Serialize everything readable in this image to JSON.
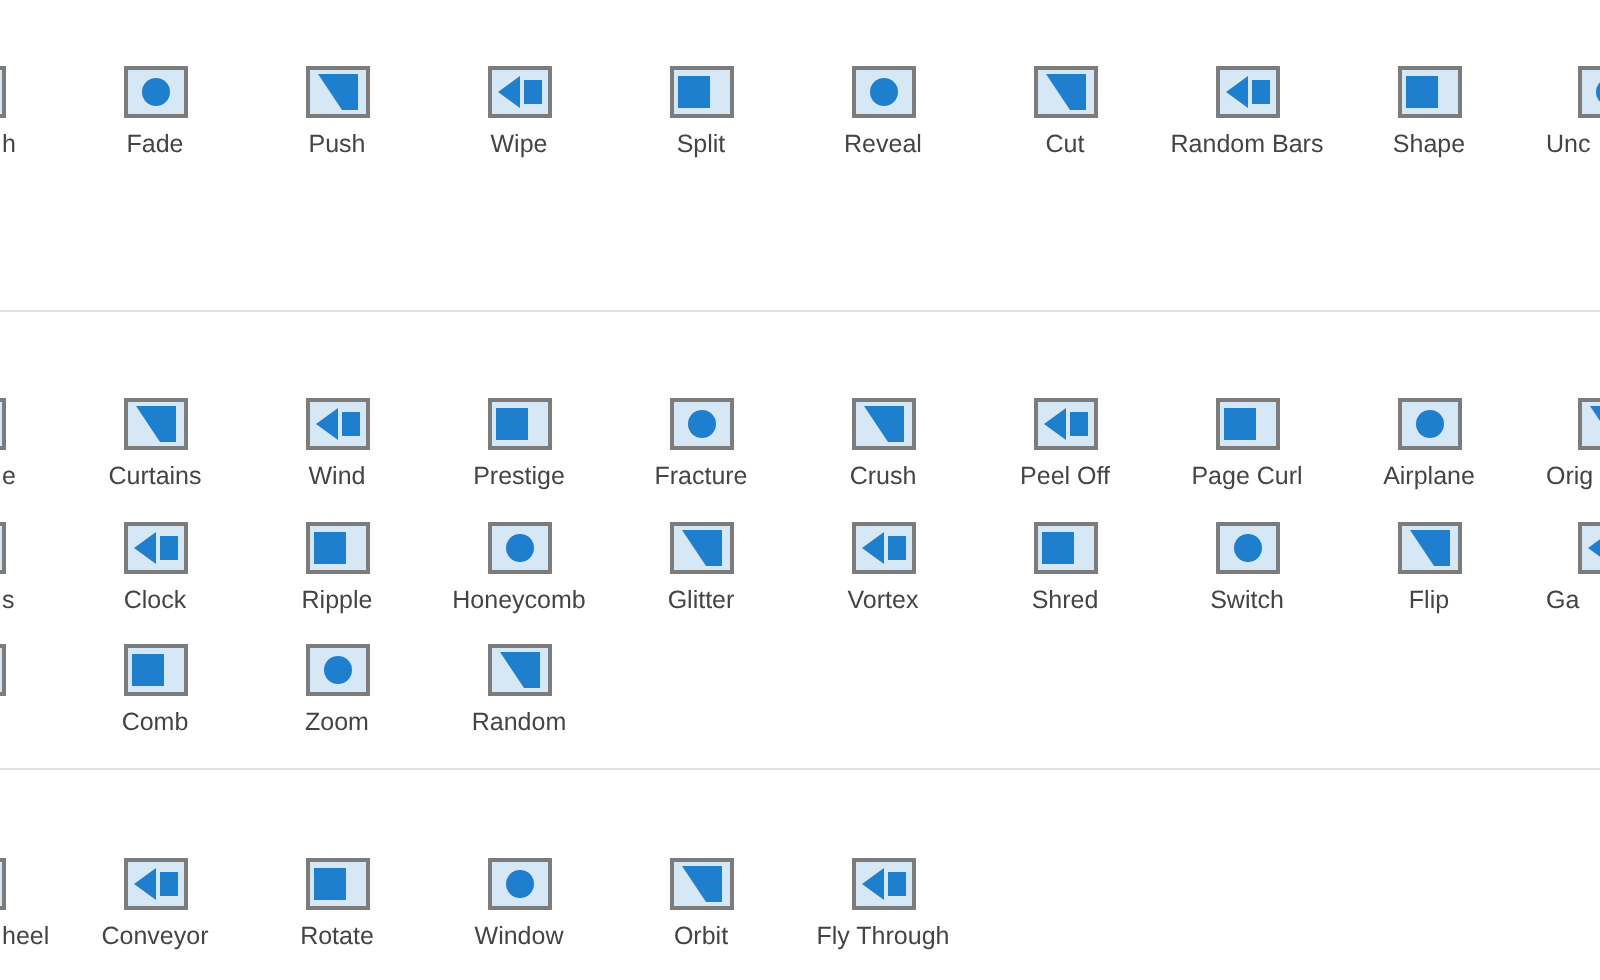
{
  "sections": [
    {
      "rows": [
        [
          {
            "label": "h"
          },
          {
            "label": "Fade"
          },
          {
            "label": "Push"
          },
          {
            "label": "Wipe"
          },
          {
            "label": "Split"
          },
          {
            "label": "Reveal"
          },
          {
            "label": "Cut"
          },
          {
            "label": "Random Bars"
          },
          {
            "label": "Shape"
          },
          {
            "label": "Unc"
          }
        ]
      ]
    },
    {
      "rows": [
        [
          {
            "label": "e"
          },
          {
            "label": "Curtains"
          },
          {
            "label": "Wind"
          },
          {
            "label": "Prestige"
          },
          {
            "label": "Fracture"
          },
          {
            "label": "Crush"
          },
          {
            "label": "Peel Off"
          },
          {
            "label": "Page Curl"
          },
          {
            "label": "Airplane"
          },
          {
            "label": "Orig"
          }
        ],
        [
          {
            "label": "s"
          },
          {
            "label": "Clock"
          },
          {
            "label": "Ripple"
          },
          {
            "label": "Honeycomb"
          },
          {
            "label": "Glitter"
          },
          {
            "label": "Vortex"
          },
          {
            "label": "Shred"
          },
          {
            "label": "Switch"
          },
          {
            "label": "Flip"
          },
          {
            "label": "Ga"
          }
        ],
        [
          {},
          {
            "label": "Comb"
          },
          {
            "label": "Zoom"
          },
          {
            "label": "Random"
          }
        ]
      ]
    },
    {
      "rows": [
        [
          {
            "label": "heel"
          },
          {
            "label": "Conveyor"
          },
          {
            "label": "Rotate"
          },
          {
            "label": "Window"
          },
          {
            "label": "Orbit"
          },
          {
            "label": "Fly Through"
          }
        ]
      ]
    }
  ]
}
